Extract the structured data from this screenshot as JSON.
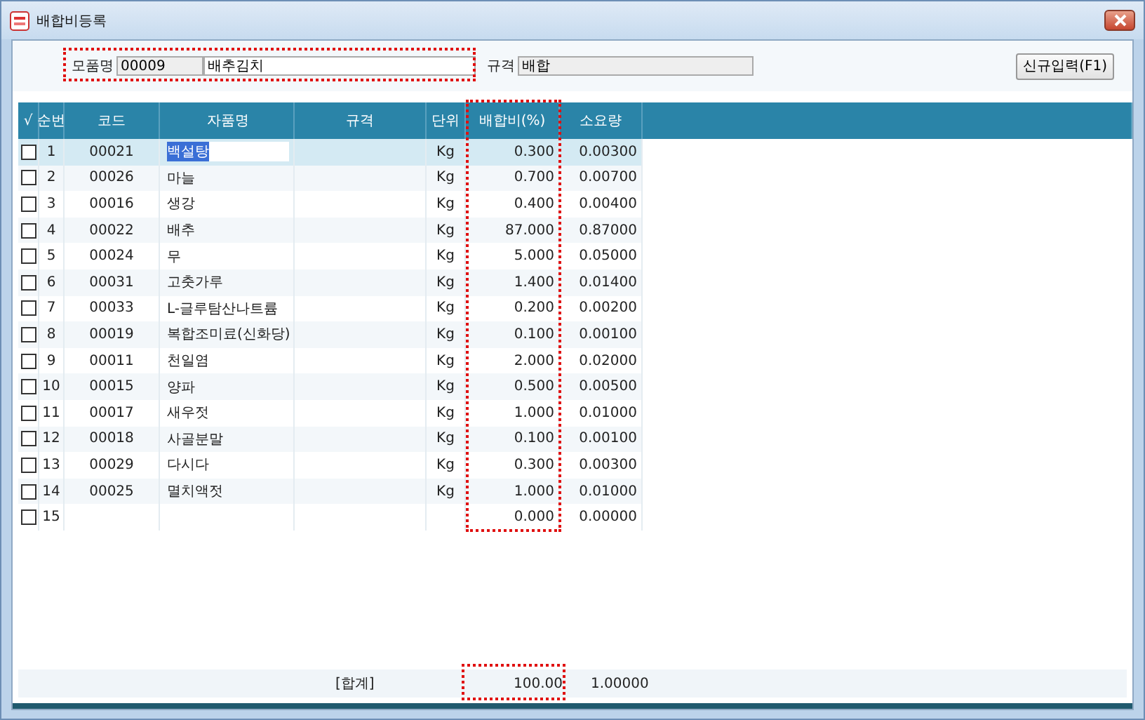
{
  "window": {
    "title": "배합비등록"
  },
  "product": {
    "label": "모품명",
    "code": "00009",
    "name": "배추김치"
  },
  "spec": {
    "label": "규격",
    "value": "배합"
  },
  "new_button": "신규입력(F1)",
  "columns": [
    "√",
    "순번",
    "코드",
    "자품명",
    "규격",
    "단위",
    "배합비(%)",
    "소요량"
  ],
  "rows": [
    {
      "checked": false,
      "selected": true,
      "no": "1",
      "code": "00021",
      "name": "백설탕",
      "unit": "Kg",
      "ratio": "0.300",
      "amount": "0.00300"
    },
    {
      "checked": false,
      "selected": false,
      "no": "2",
      "code": "00026",
      "name": "마늘",
      "unit": "Kg",
      "ratio": "0.700",
      "amount": "0.00700"
    },
    {
      "checked": false,
      "selected": false,
      "no": "3",
      "code": "00016",
      "name": "생강",
      "unit": "Kg",
      "ratio": "0.400",
      "amount": "0.00400"
    },
    {
      "checked": false,
      "selected": false,
      "no": "4",
      "code": "00022",
      "name": "배추",
      "unit": "Kg",
      "ratio": "87.000",
      "amount": "0.87000"
    },
    {
      "checked": false,
      "selected": false,
      "no": "5",
      "code": "00024",
      "name": "무",
      "unit": "Kg",
      "ratio": "5.000",
      "amount": "0.05000"
    },
    {
      "checked": false,
      "selected": false,
      "no": "6",
      "code": "00031",
      "name": "고춧가루",
      "unit": "Kg",
      "ratio": "1.400",
      "amount": "0.01400"
    },
    {
      "checked": false,
      "selected": false,
      "no": "7",
      "code": "00033",
      "name": "L-글루탐산나트륨",
      "unit": "Kg",
      "ratio": "0.200",
      "amount": "0.00200"
    },
    {
      "checked": false,
      "selected": false,
      "no": "8",
      "code": "00019",
      "name": "복합조미료(신화당)",
      "unit": "Kg",
      "ratio": "0.100",
      "amount": "0.00100"
    },
    {
      "checked": false,
      "selected": false,
      "no": "9",
      "code": "00011",
      "name": "천일염",
      "unit": "Kg",
      "ratio": "2.000",
      "amount": "0.02000"
    },
    {
      "checked": false,
      "selected": false,
      "no": "10",
      "code": "00015",
      "name": "양파",
      "unit": "Kg",
      "ratio": "0.500",
      "amount": "0.00500"
    },
    {
      "checked": false,
      "selected": false,
      "no": "11",
      "code": "00017",
      "name": "새우젓",
      "unit": "Kg",
      "ratio": "1.000",
      "amount": "0.01000"
    },
    {
      "checked": false,
      "selected": false,
      "no": "12",
      "code": "00018",
      "name": "사골분말",
      "unit": "Kg",
      "ratio": "0.100",
      "amount": "0.00100"
    },
    {
      "checked": false,
      "selected": false,
      "no": "13",
      "code": "00029",
      "name": "다시다",
      "unit": "Kg",
      "ratio": "0.300",
      "amount": "0.00300"
    },
    {
      "checked": false,
      "selected": false,
      "no": "14",
      "code": "00025",
      "name": "멸치액젓",
      "unit": "Kg",
      "ratio": "1.000",
      "amount": "0.01000"
    },
    {
      "checked": false,
      "selected": false,
      "no": "15",
      "ratio": "0.000",
      "amount": "0.00000"
    }
  ],
  "footer": {
    "label": "[합계]",
    "ratio_total": "100.00",
    "amount_total": "1.00000"
  }
}
